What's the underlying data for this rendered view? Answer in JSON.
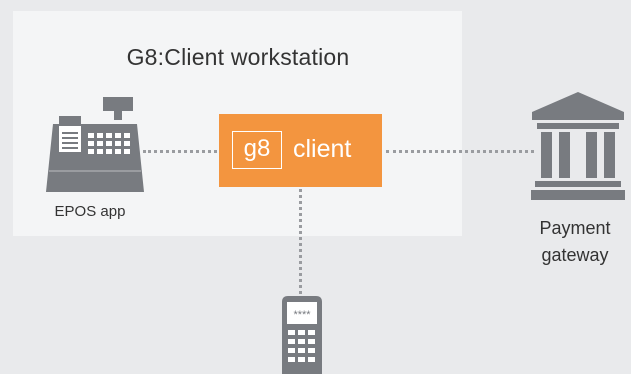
{
  "workstation": {
    "title": "G8:Client workstation"
  },
  "client": {
    "logo_text": "g8",
    "label": "client",
    "color": "#f3953f"
  },
  "epos": {
    "label": "EPOS app",
    "icon": "cash-register-icon"
  },
  "gateway": {
    "label_line1": "Payment",
    "label_line2": "gateway",
    "icon": "bank-building-icon"
  },
  "terminal": {
    "icon": "card-terminal-icon",
    "screen_text": "****"
  },
  "colors": {
    "icon_gray": "#787b80",
    "connector": "#9a9ca0",
    "background": "#e9eaec",
    "panel": "#f4f5f6"
  }
}
